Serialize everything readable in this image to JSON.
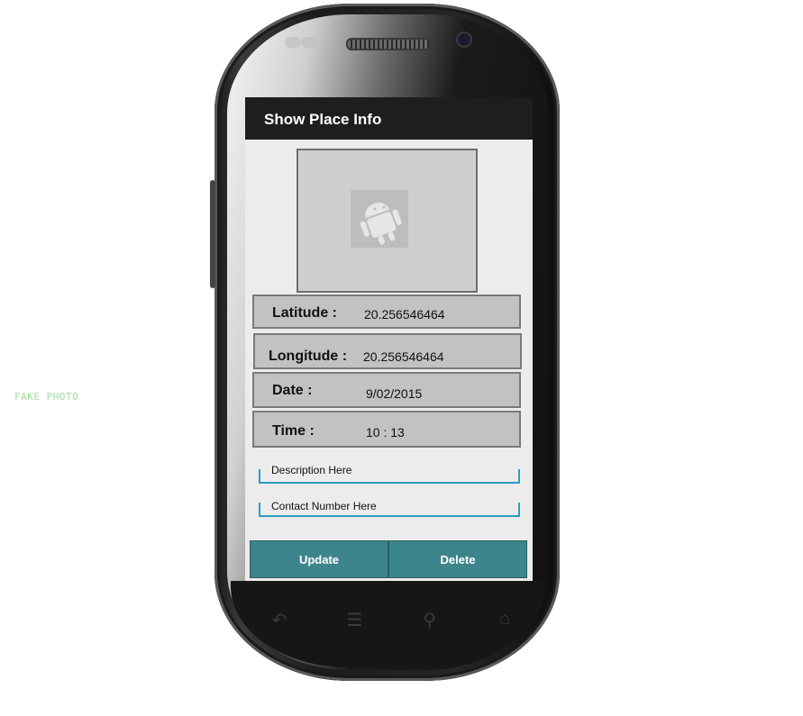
{
  "watermark": "FAKE PHOTO",
  "app": {
    "title": "Show Place Info"
  },
  "image": {
    "icon": "android-placeholder-icon"
  },
  "details": {
    "latitude_label": "Latitude :",
    "latitude_value": "20.256546464",
    "longitude_label": "Longitude :",
    "longitude_value": "20.256546464",
    "date_label": "Date :",
    "date_value": "9/02/2015",
    "time_label": "Time :",
    "time_value": "10 : 13"
  },
  "inputs": {
    "description_placeholder": "Description Here",
    "contact_placeholder": "Contact Number Here"
  },
  "buttons": {
    "update": "Update",
    "delete": "Delete"
  },
  "nav_icons": [
    "back-icon",
    "menu-icon",
    "search-icon",
    "home-icon"
  ],
  "colors": {
    "title_bar": "#1e1e1e",
    "button": "#3d858c",
    "input_underline": "#2a9ec3"
  }
}
